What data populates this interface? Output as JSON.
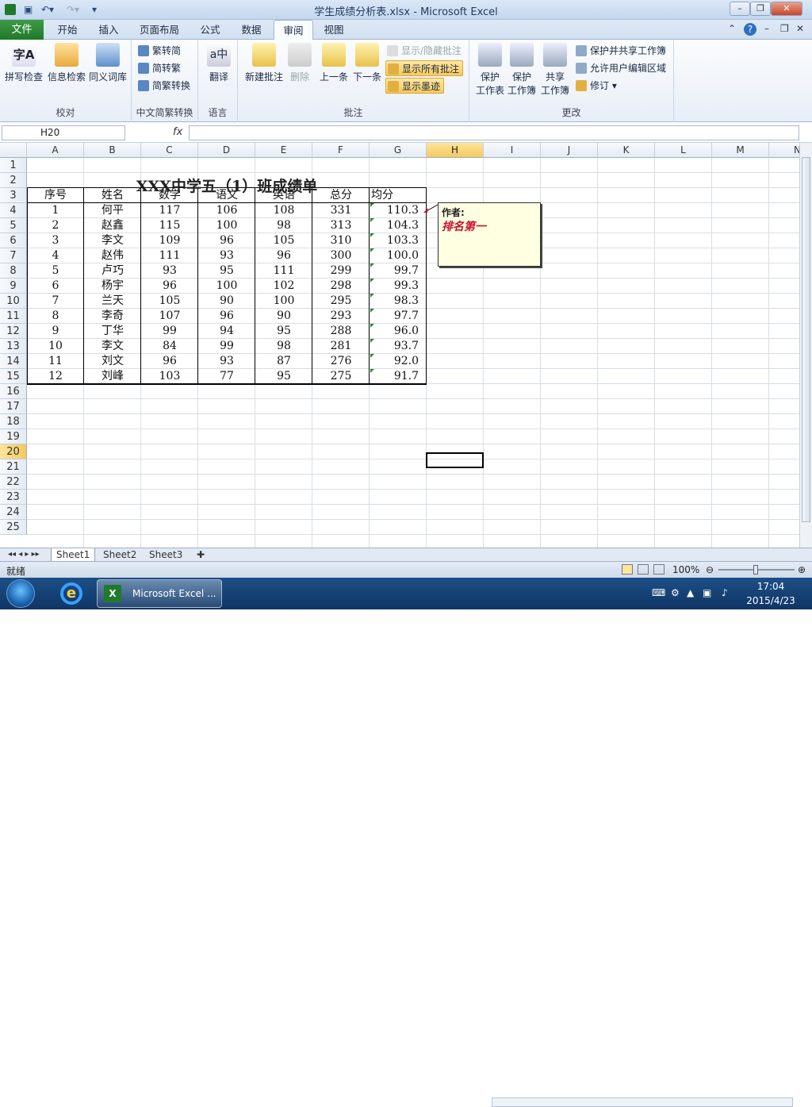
{
  "window": {
    "title": "学生成绩分析表.xlsx - Microsoft Excel"
  },
  "ribbon_tabs": [
    "文件",
    "开始",
    "插入",
    "页面布局",
    "公式",
    "数据",
    "审阅",
    "视图"
  ],
  "active_tab": "审阅",
  "groups": {
    "proofing": {
      "label": "校对",
      "buttons": [
        "拼写检查",
        "信息检索",
        "同义词库"
      ]
    },
    "chinese": {
      "label": "中文简繁转换",
      "buttons": [
        "繁转简",
        "简转繁",
        "简繁转换"
      ]
    },
    "language": {
      "label": "语言",
      "buttons": [
        "翻译"
      ]
    },
    "comments": {
      "label": "批注",
      "buttons": [
        "新建批注",
        "删除",
        "上一条",
        "下一条"
      ],
      "toggles": [
        "显示/隐藏批注",
        "显示所有批注",
        "显示墨迹"
      ]
    },
    "changes": {
      "label": "更改",
      "buttons": [
        "保护工作表",
        "保护工作簿",
        "共享工作簿"
      ],
      "small": [
        "保护并共享工作簿",
        "允许用户编辑区域",
        "修订"
      ]
    }
  },
  "changes_btn_lines": [
    "保护",
    "工作表",
    "保护",
    "工作簿",
    "共享",
    "工作簿"
  ],
  "formula_bar": {
    "name_box": "H20",
    "fx": "fx",
    "value": ""
  },
  "columns": [
    "A",
    "B",
    "C",
    "D",
    "E",
    "F",
    "G",
    "H",
    "I",
    "J",
    "K",
    "L",
    "M",
    "N"
  ],
  "rows": [
    "1",
    "2",
    "3",
    "4",
    "5",
    "6",
    "7",
    "8",
    "9",
    "10",
    "11",
    "12",
    "13",
    "14",
    "15",
    "16",
    "17",
    "18",
    "19",
    "20",
    "21",
    "22",
    "23",
    "24",
    "25"
  ],
  "table": {
    "title": "XXX中学五（1）班成绩单",
    "headers": [
      "序号",
      "姓名",
      "数学",
      "语文",
      "英语",
      "总分",
      "均分"
    ],
    "rows": [
      [
        "1",
        "何平",
        "117",
        "106",
        "108",
        "331",
        "110.3"
      ],
      [
        "2",
        "赵鑫",
        "115",
        "100",
        "98",
        "313",
        "104.3"
      ],
      [
        "3",
        "李文",
        "109",
        "96",
        "105",
        "310",
        "103.3"
      ],
      [
        "4",
        "赵伟",
        "111",
        "93",
        "96",
        "300",
        "100.0"
      ],
      [
        "5",
        "卢巧",
        "93",
        "95",
        "111",
        "299",
        "99.7"
      ],
      [
        "6",
        "杨宇",
        "96",
        "100",
        "102",
        "298",
        "99.3"
      ],
      [
        "7",
        "兰天",
        "105",
        "90",
        "100",
        "295",
        "98.3"
      ],
      [
        "8",
        "李奇",
        "107",
        "96",
        "90",
        "293",
        "97.7"
      ],
      [
        "9",
        "丁华",
        "99",
        "94",
        "95",
        "288",
        "96.0"
      ],
      [
        "10",
        "李文",
        "84",
        "99",
        "98",
        "281",
        "93.7"
      ],
      [
        "11",
        "刘文",
        "96",
        "93",
        "87",
        "276",
        "92.0"
      ],
      [
        "12",
        "刘峰",
        "103",
        "77",
        "95",
        "275",
        "91.7"
      ]
    ]
  },
  "comment": {
    "author": "作者:",
    "text": "排名第一"
  },
  "sheet_tabs": [
    "Sheet1",
    "Sheet2",
    "Sheet3"
  ],
  "status": {
    "ready": "就绪",
    "zoom": "100%"
  },
  "taskbar": {
    "app_label": "Microsoft Excel ...",
    "time": "17:04",
    "date": "2015/4/23"
  }
}
